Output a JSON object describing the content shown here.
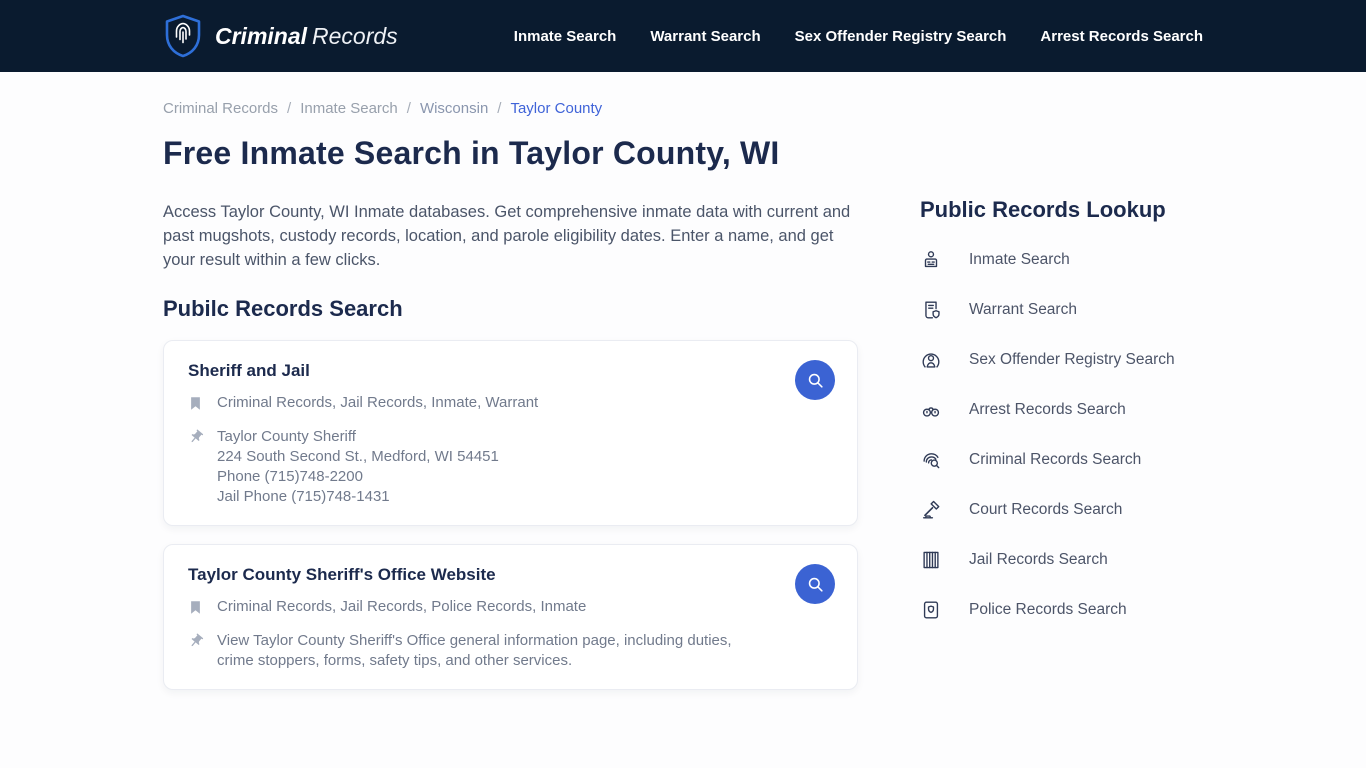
{
  "header": {
    "brand": {
      "bold": "Criminal",
      "regular": "Records"
    },
    "nav": [
      {
        "label": "Inmate Search"
      },
      {
        "label": "Warrant Search"
      },
      {
        "label": "Sex Offender Registry Search"
      },
      {
        "label": "Arrest Records Search"
      }
    ]
  },
  "breadcrumb": {
    "separator": "/",
    "items": [
      {
        "label": "Criminal Records"
      },
      {
        "label": "Inmate Search"
      },
      {
        "label": "Wisconsin"
      },
      {
        "label": "Taylor County"
      }
    ]
  },
  "page": {
    "title": "Free Inmate Search in Taylor County, WI",
    "intro": "Access Taylor County, WI Inmate databases. Get comprehensive inmate data with current and past mugshots, custody records, location, and parole eligibility dates. Enter a name, and get your result within a few clicks.",
    "section_heading": "Pubilc Records Search"
  },
  "cards": [
    {
      "title": "Sheriff and Jail",
      "tags": "Criminal Records, Jail Records, Inmate, Warrant",
      "details": [
        "Taylor County Sheriff",
        "224 South Second St., Medford, WI 54451",
        "Phone (715)748-2200",
        "Jail Phone (715)748-1431"
      ],
      "action_icon": "search-icon"
    },
    {
      "title": "Taylor County Sheriff's Office Website",
      "tags": "Criminal Records, Jail Records, Police Records, Inmate",
      "details": [
        "View Taylor County Sheriff's Office general information page, including duties, crime stoppers, forms, safety tips, and other services."
      ],
      "action_icon": "search-icon"
    }
  ],
  "sidebar": {
    "heading": "Public Records Lookup",
    "items": [
      {
        "label": "Inmate Search",
        "icon": "inmate-search-icon"
      },
      {
        "label": "Warrant Search",
        "icon": "warrant-search-icon"
      },
      {
        "label": "Sex Offender Registry Search",
        "icon": "sex-offender-registry-icon"
      },
      {
        "label": "Arrest Records Search",
        "icon": "arrest-records-icon"
      },
      {
        "label": "Criminal Records Search",
        "icon": "criminal-records-search-icon"
      },
      {
        "label": "Court Records Search",
        "icon": "court-records-icon"
      },
      {
        "label": "Jail Records Search",
        "icon": "jail-records-icon"
      },
      {
        "label": "Police Records Search",
        "icon": "police-records-icon"
      }
    ]
  },
  "colors": {
    "nav_bg": "#0a1b2f",
    "accent_blue": "#3b63d3",
    "logo_blue": "#2e6fd8",
    "heading_navy": "#1c2a4d",
    "breadcrumb_gray": "#98a0ac",
    "breadcrumb_active": "#3f63d8",
    "body_gray": "#4b5569",
    "muted_gray": "#717a8c"
  }
}
